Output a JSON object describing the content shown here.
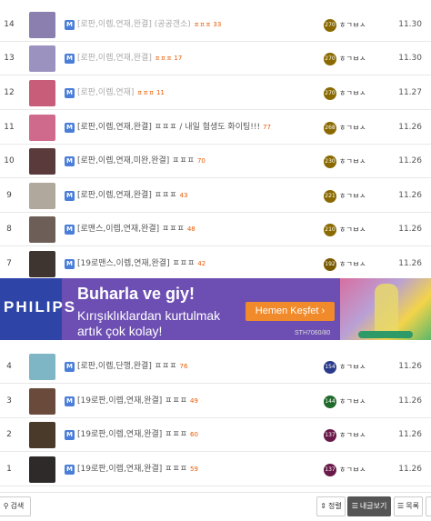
{
  "rows": [
    {
      "num": "14",
      "title": "[로판,이렙,연재,완결] (공공갠소)",
      "dim": true,
      "cmt": "ㅍㅍㅍ 33",
      "level": "270",
      "nick": "ㅎㄱㅂㅅ",
      "date": "11.30",
      "lvl_color": "#8a6a00",
      "thumb_color": "#8b7fb0"
    },
    {
      "num": "13",
      "title": "[로판,이렙,연재,완결]",
      "dim": true,
      "cmt": "ㅍㅍㅍ 17",
      "level": "270",
      "nick": "ㅎㄱㅂㅅ",
      "date": "11.30",
      "lvl_color": "#8a6a00",
      "thumb_color": "#9c92bf"
    },
    {
      "num": "12",
      "title": "[로판,이렙,연재]",
      "dim": true,
      "cmt": "ㅍㅍㅍ 11",
      "level": "270",
      "nick": "ㅎㄱㅂㅅ",
      "date": "11.27",
      "lvl_color": "#8a6a00",
      "thumb_color": "#c85d7a"
    },
    {
      "num": "11",
      "title": "[로판,이렙,연재,완결] ㅍㅍㅍ / 내일 혐생도 화이팅!!!",
      "dim": false,
      "cmt": "77",
      "level": "268",
      "nick": "ㅎㄱㅂㅅ",
      "date": "11.26",
      "lvl_color": "#8a6a00",
      "thumb_color": "#d06a8c"
    },
    {
      "num": "10",
      "title": "[로판,이렙,연재,미완,완결] ㅍㅍㅍ",
      "dim": false,
      "cmt": "70",
      "level": "230",
      "nick": "ㅎㄱㅂㅅ",
      "date": "11.26",
      "lvl_color": "#8a6a00",
      "thumb_color": "#5a3a3a"
    },
    {
      "num": "9",
      "title": "[로판,이렙,연재,완결] ㅍㅍㅍ",
      "dim": false,
      "cmt": "43",
      "level": "221",
      "nick": "ㅎㄱㅂㅅ",
      "date": "11.26",
      "lvl_color": "#8a6a00",
      "thumb_color": "#b0a89c"
    },
    {
      "num": "8",
      "title": "[로맨스,이렙,연재,완결] ㅍㅍㅍ",
      "dim": false,
      "cmt": "48",
      "level": "210",
      "nick": "ㅎㄱㅂㅅ",
      "date": "11.26",
      "lvl_color": "#8a6a00",
      "thumb_color": "#6e5e58"
    },
    {
      "num": "7",
      "title": "[19로맨스,이렙,연재,완결] ㅍㅍㅍ",
      "dim": false,
      "cmt": "42",
      "level": "192",
      "nick": "ㅎㄱㅂㅅ",
      "date": "11.26",
      "lvl_color": "#7a5a00",
      "thumb_color": "#3e3430"
    },
    {
      "num": "4",
      "title": "[로판,이렙,단행,완결] ㅍㅍㅍ",
      "dim": false,
      "cmt": "76",
      "level": "154",
      "nick": "ㅎㄱㅂㅅ",
      "date": "11.26",
      "lvl_color": "#2a3a8a",
      "thumb_color": "#7fb6c6"
    },
    {
      "num": "3",
      "title": "[19로판,이렙,연재,완결] ㅍㅍㅍ",
      "dim": false,
      "cmt": "49",
      "level": "144",
      "nick": "ㅎㄱㅂㅅ",
      "date": "11.26",
      "lvl_color": "#1f6a2a",
      "thumb_color": "#6a4a3a"
    },
    {
      "num": "2",
      "title": "[19로판,이렙,연재,완결] ㅍㅍㅍ",
      "dim": false,
      "cmt": "60",
      "level": "137",
      "nick": "ㅎㄱㅂㅅ",
      "date": "11.26",
      "lvl_color": "#6a1a4a",
      "thumb_color": "#4a3a2a"
    },
    {
      "num": "1",
      "title": "[19로판,이렙,연재,완결] ㅍㅍㅍ",
      "dim": false,
      "cmt": "59",
      "level": "137",
      "nick": "ㅎㄱㅂㅅ",
      "date": "11.26",
      "lvl_color": "#6a1a4a",
      "thumb_color": "#2e2a2a"
    }
  ],
  "ad": {
    "brand": "PHILIPS",
    "headline": "Buharla ve giy!",
    "line1": "Kırışıklıklardan kurtulmak",
    "line2": "artık çok kolay!",
    "cta": "Hemen Keşfet ›",
    "model": "STH7060/80"
  },
  "footer": {
    "search_label": "검색",
    "sort_label": "정렬",
    "mypost_label": "내글보기",
    "list_label": "목록"
  },
  "colors": {
    "accent": "#4a7ed8",
    "comment": "#e85a00",
    "ad_bg": "#6d4fb3",
    "ad_cta": "#f08a2a"
  }
}
